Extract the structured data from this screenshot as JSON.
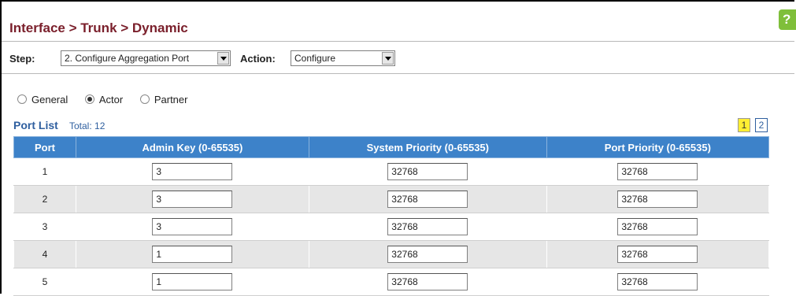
{
  "breadcrumb": "Interface > Trunk > Dynamic",
  "help_label": "?",
  "step": {
    "label": "Step:",
    "value": "2. Configure Aggregation Port"
  },
  "action": {
    "label": "Action:",
    "value": "Configure"
  },
  "radios": [
    {
      "label": "General",
      "checked": false
    },
    {
      "label": "Actor",
      "checked": true
    },
    {
      "label": "Partner",
      "checked": false
    }
  ],
  "port_list": {
    "title": "Port List",
    "total": "Total: 12",
    "pages": [
      "1",
      "2"
    ],
    "current_page": "1"
  },
  "table": {
    "headers": [
      "Port",
      "Admin Key (0-65535)",
      "System Priority (0-65535)",
      "Port Priority (0-65535)"
    ],
    "rows": [
      {
        "port": "1",
        "admin_key": "3",
        "system_priority": "32768",
        "port_priority": "32768"
      },
      {
        "port": "2",
        "admin_key": "3",
        "system_priority": "32768",
        "port_priority": "32768"
      },
      {
        "port": "3",
        "admin_key": "3",
        "system_priority": "32768",
        "port_priority": "32768"
      },
      {
        "port": "4",
        "admin_key": "1",
        "system_priority": "32768",
        "port_priority": "32768"
      },
      {
        "port": "5",
        "admin_key": "1",
        "system_priority": "32768",
        "port_priority": "32768"
      }
    ]
  },
  "colors": {
    "title": "#7a1f2b",
    "header_bg": "#3d82c9",
    "link": "#2f5f9f",
    "help": "#7fbf3a"
  }
}
